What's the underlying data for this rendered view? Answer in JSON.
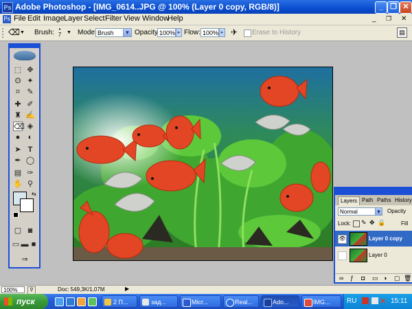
{
  "window": {
    "app_title": "Adobe Photoshop - [IMG_0614..JPG @ 100% (Layer 0 copy, RGB/8)]",
    "buttons": {
      "minimize": "_",
      "restore": "❐",
      "close": "✕"
    }
  },
  "menu": [
    "File",
    "Edit",
    "Image",
    "Layer",
    "Select",
    "Filter",
    "View",
    "Window",
    "Help"
  ],
  "options": {
    "brush_label": "Brush:",
    "brush_size": "7",
    "mode_label": "Mode:",
    "mode_value": "Brush",
    "opacity_label": "Opacity:",
    "opacity_value": "100%",
    "flow_label": "Flow:",
    "flow_value": "100%",
    "erase_history": "Erase to History"
  },
  "layers_panel": {
    "tabs": [
      "Layers",
      "Path",
      "Paths",
      "History"
    ],
    "blend_mode": "Normal",
    "opacity_label": "Opacity",
    "lock_label": "Lock:",
    "fill_label": "Fill",
    "layers": [
      {
        "name": "Layer 0 copy",
        "selected": true
      },
      {
        "name": "Layer 0",
        "selected": false
      }
    ]
  },
  "status": {
    "zoom": "100%",
    "doc_info": "Doc: 549,3K/1,07M"
  },
  "taskbar": {
    "start_label": "пуск",
    "tasks": [
      "2 П...",
      "зад...",
      "Micr...",
      "Real...",
      "Ado...",
      "IMG..."
    ],
    "language": "RU",
    "clock": "15:11"
  },
  "colors": {
    "title_bar": "#0a4fd0",
    "panel_border": "#1b4fd6",
    "layer_selected": "#316ac5",
    "taskbar": "#245edb",
    "start_button": "#3a9a3a"
  }
}
